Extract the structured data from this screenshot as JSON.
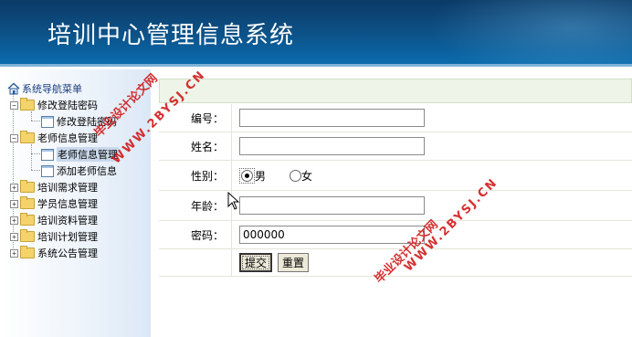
{
  "header": {
    "title": "培训中心管理信息系统"
  },
  "sidebar": {
    "root_label": "系统导航菜单",
    "items": [
      {
        "label": "修改登陆密码",
        "type": "folder",
        "expanded": true
      },
      {
        "label": "修改登陆密码",
        "type": "doc"
      },
      {
        "label": "老师信息管理",
        "type": "folder",
        "expanded": true
      },
      {
        "label": "老师信息管理",
        "type": "doc",
        "selected": true
      },
      {
        "label": "添加老师信息",
        "type": "doc"
      },
      {
        "label": "培训需求管理",
        "type": "folder"
      },
      {
        "label": "学员信息管理",
        "type": "folder"
      },
      {
        "label": "培训资料管理",
        "type": "folder"
      },
      {
        "label": "培训计划管理",
        "type": "folder"
      },
      {
        "label": "系统公告管理",
        "type": "folder"
      }
    ]
  },
  "form": {
    "fields": {
      "id": {
        "label": "编号：",
        "value": ""
      },
      "name": {
        "label": "姓名：",
        "value": ""
      },
      "gender": {
        "label": "性别：",
        "option_male": "男",
        "option_female": "女",
        "selected": "男"
      },
      "age": {
        "label": "年龄：",
        "value": ""
      },
      "password": {
        "label": "密码：",
        "value": "000000"
      }
    },
    "buttons": {
      "submit": "提交",
      "reset": "重置"
    }
  },
  "watermarks": {
    "text1": "毕业设计论文网",
    "text2": "WWW.2BYSJ.CN"
  },
  "colors": {
    "header_bg": "#0d4f84",
    "watermark": "#d21a1a",
    "form_header_bg": "#eef4e8"
  }
}
